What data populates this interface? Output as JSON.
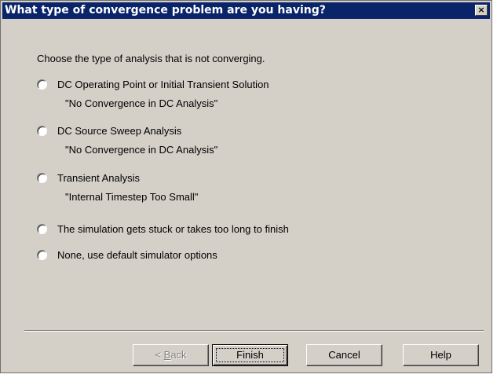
{
  "window": {
    "title": "What type of convergence problem are you having?",
    "close_glyph": "×"
  },
  "instruction": "Choose the type of analysis that is not converging.",
  "options": [
    {
      "label": "DC Operating Point or Initial Transient Solution",
      "sub": "\"No Convergence in DC Analysis\"",
      "selected": false
    },
    {
      "label": "DC Source Sweep Analysis",
      "sub": "\"No Convergence in DC Analysis\"",
      "selected": false
    },
    {
      "label": "Transient Analysis",
      "sub": "\"Internal Timestep Too Small\"",
      "selected": false
    },
    {
      "label": "The simulation gets stuck or takes too long to finish",
      "sub": "",
      "selected": false
    },
    {
      "label": "None, use default simulator options",
      "sub": "",
      "selected": false
    }
  ],
  "buttons": {
    "back_prefix": "< ",
    "back_mnemonic": "B",
    "back_rest": "ack",
    "finish": "Finish",
    "cancel": "Cancel",
    "help": "Help"
  },
  "colors": {
    "title_bar": "#0a246a",
    "dialog_face": "#d4d0c8"
  }
}
